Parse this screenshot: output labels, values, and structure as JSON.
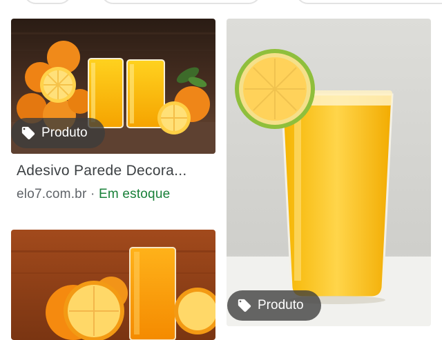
{
  "results": [
    {
      "badge_label": "Produto",
      "badge_icon": "tag-icon",
      "title": "Adesivo Parede Decora...",
      "source": "elo7.com.br",
      "separator": " · ",
      "availability": "Em estoque"
    },
    {
      "badge_label": "Produto",
      "badge_icon": "tag-icon"
    }
  ],
  "colors": {
    "availability": "#188038",
    "title": "#3c4043",
    "source": "#5f6368",
    "badge_bg": "rgba(60,60,60,0.78)"
  }
}
